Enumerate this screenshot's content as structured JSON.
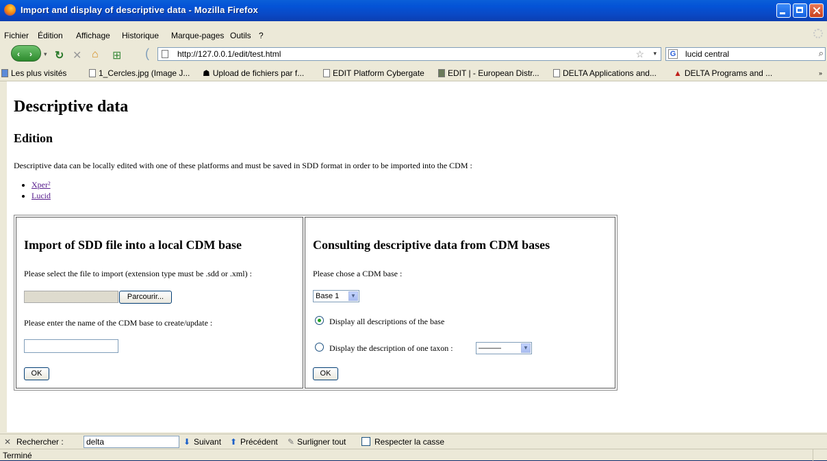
{
  "window": {
    "title": "Import and display of descriptive data - Mozilla Firefox"
  },
  "menu": [
    "Fichier",
    "Édition",
    "Affichage",
    "Historique",
    "Marque-pages",
    "Outils",
    "?"
  ],
  "nav": {
    "url": "http://127.0.0.1/edit/test.html",
    "search_value": "lucid central"
  },
  "bookmarks": [
    "Les plus visités",
    "1_Cercles.jpg (Image J...",
    "Upload de fichiers par f...",
    "EDIT Platform Cybergate",
    "EDIT | - European Distr...",
    "DELTA Applications and...",
    "DELTA Programs and ...",
    "»"
  ],
  "page": {
    "title": "Descriptive data",
    "subtitle": "Edition",
    "intro": "Descriptive data can be locally edited with one of these platforms and must be saved in SDD format in order to be imported into the CDM :",
    "links": [
      "Xper²",
      "Lucid"
    ],
    "import": {
      "heading": "Import of SDD file into a local CDM base",
      "file_label": "Please select the file to import (extension type must be .sdd or .xml) :",
      "browse_button": "Parcourir...",
      "name_label": "Please enter the name of the CDM base to create/update :",
      "ok_button": "OK"
    },
    "consult": {
      "heading": "Consulting descriptive data from CDM bases",
      "base_label": "Please chose a CDM base :",
      "base_selected": "Base 1",
      "radio_all": "Display all descriptions of the base",
      "radio_one": "Display the description of one taxon :",
      "taxon_selected": "———",
      "ok_button": "OK"
    }
  },
  "findbar": {
    "label": "Rechercher :",
    "value": "delta",
    "next": "Suivant",
    "previous": "Précédent",
    "highlight": "Surligner tout",
    "match_case": "Respecter la casse"
  },
  "status": "Terminé"
}
